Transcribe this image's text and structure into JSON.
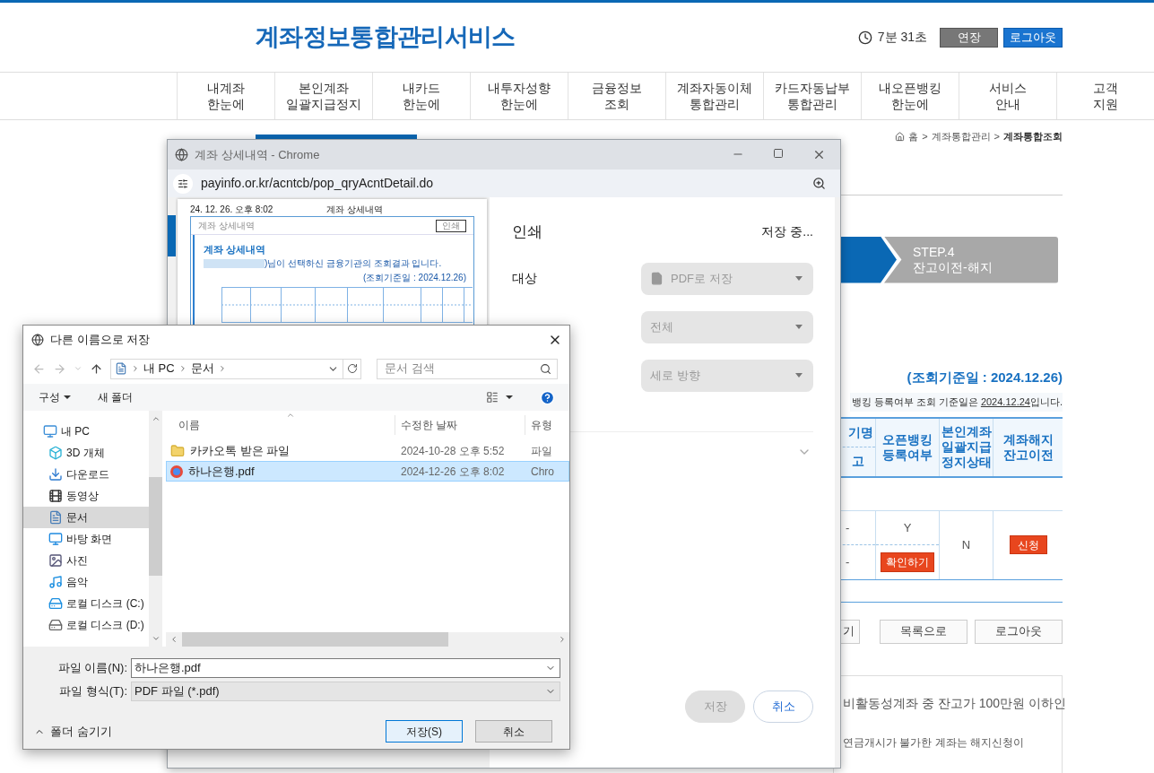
{
  "header": {
    "title": "계좌정보통합관리서비스",
    "timer": "7분 31초",
    "buttons": [
      {
        "label": "연장",
        "kind": "extend"
      },
      {
        "label": "로그아웃",
        "kind": "logout"
      }
    ]
  },
  "nav": [
    {
      "label": "내계좌\n한눈에"
    },
    {
      "label": "본인계좌\n일괄지급정지"
    },
    {
      "label": "내카드\n한눈에"
    },
    {
      "label": "내투자성향\n한눈에"
    },
    {
      "label": "금융정보\n조회"
    },
    {
      "label": "계좌자동이체\n통합관리"
    },
    {
      "label": "카드자동납부\n통합관리"
    },
    {
      "label": "내오픈뱅킹\n한눈에"
    },
    {
      "label": "서비스\n안내"
    },
    {
      "label": "고객\n지원"
    }
  ],
  "page": {
    "breadcrumb": [
      "홈",
      "계좌통합관리",
      "계좌통합조회"
    ],
    "breadcrumb_separator": ">",
    "step": {
      "label": "STEP.4",
      "title": "잔고이전-해지"
    },
    "query_date": "(조회기준일 : 2024.12.26)",
    "notice": {
      "before": "뱅킹 등록여부 조회 기준일은 ",
      "date": "2024.12.24",
      "after": "입니다."
    },
    "table": {
      "columns": [
        "기명\n고",
        "오픈뱅킹\n등록여부",
        "본인계좌\n일괄지급\n정지상태",
        "계좌해지\n잔고이전"
      ],
      "row": {
        "column_1": [
          "-",
          "-"
        ],
        "open_banking": "Y",
        "open_banking_button": "확인하기",
        "stop_status": "N",
        "close_button": "신청"
      }
    },
    "buttons": [
      "기",
      "목록으로",
      "로그아웃"
    ],
    "info": [
      "비활동성계좌 중 잔고가 100만원 이하인",
      "연금개시가 불가한 계좌는 해지신청이"
    ]
  },
  "popup": {
    "title": "계좌 상세내역 - Chrome",
    "url": "payinfo.or.kr/acntcb/pop_qryAcntDetail.do",
    "preview": {
      "date": "24. 12. 26. 오후 8:02",
      "page_title": "계좌 상세내역",
      "box_title": "계좌 상세내역",
      "print_button": "인쇄",
      "heading": "계좌 상세내역",
      "sentence": ")님이 선택하신 금융기관의 조회결과 입니다.",
      "query_date": "(조회기준일 : 2024.12.26)"
    },
    "print": {
      "title": "인쇄",
      "status": "저장 중...",
      "fields": [
        {
          "label": "대상",
          "value": "PDF로 저장",
          "kind": "destination"
        },
        {
          "value": "전체",
          "kind": "plain"
        },
        {
          "value": "세로 방향",
          "kind": "plain"
        }
      ],
      "buttons": [
        {
          "label": "저장",
          "disabled": true
        },
        {
          "label": "취소",
          "disabled": false
        }
      ]
    }
  },
  "dialog": {
    "title": "다른 이름으로 저장",
    "path": [
      "내 PC",
      "문서"
    ],
    "search_placeholder": "문서 검색",
    "toolbar": [
      "구성",
      "새 폴더"
    ],
    "nav": [
      {
        "label": "내 PC",
        "kind": "pc",
        "selected": false,
        "children": [
          {
            "label": "3D 개체",
            "kind": "cube",
            "selected": false
          },
          {
            "label": "다운로드",
            "kind": "download",
            "selected": false
          },
          {
            "label": "동영상",
            "kind": "video",
            "selected": false
          },
          {
            "label": "문서",
            "kind": "document",
            "selected": true
          },
          {
            "label": "바탕 화면",
            "kind": "desktop",
            "selected": false
          },
          {
            "label": "사진",
            "kind": "picture",
            "selected": false
          },
          {
            "label": "음악",
            "kind": "music",
            "selected": false
          },
          {
            "label": "로컬 디스크 (C:)",
            "kind": "system-drive",
            "selected": false
          },
          {
            "label": "로컬 디스크 (D:)",
            "kind": "drive",
            "selected": false
          }
        ]
      }
    ],
    "columns": [
      "이름",
      "수정한 날짜",
      "유형"
    ],
    "files": [
      {
        "name": "카카오톡 받은 파일",
        "date": "2024-10-28 오후 5:52",
        "type": "파일",
        "kind": "folder",
        "selected": false
      },
      {
        "name": "하나은행.pdf",
        "date": "2024-12-26 오후 8:02",
        "type": "Chro",
        "kind": "pdf",
        "selected": true
      }
    ],
    "file_name_label": "파일 이름(N):",
    "file_name": "하나은행.pdf",
    "file_type_label": "파일 형식(T):",
    "file_type": "PDF 파일 (*.pdf)",
    "hide_folders": "폴더 숨기기",
    "buttons": [
      "저장(S)",
      "취소"
    ]
  }
}
